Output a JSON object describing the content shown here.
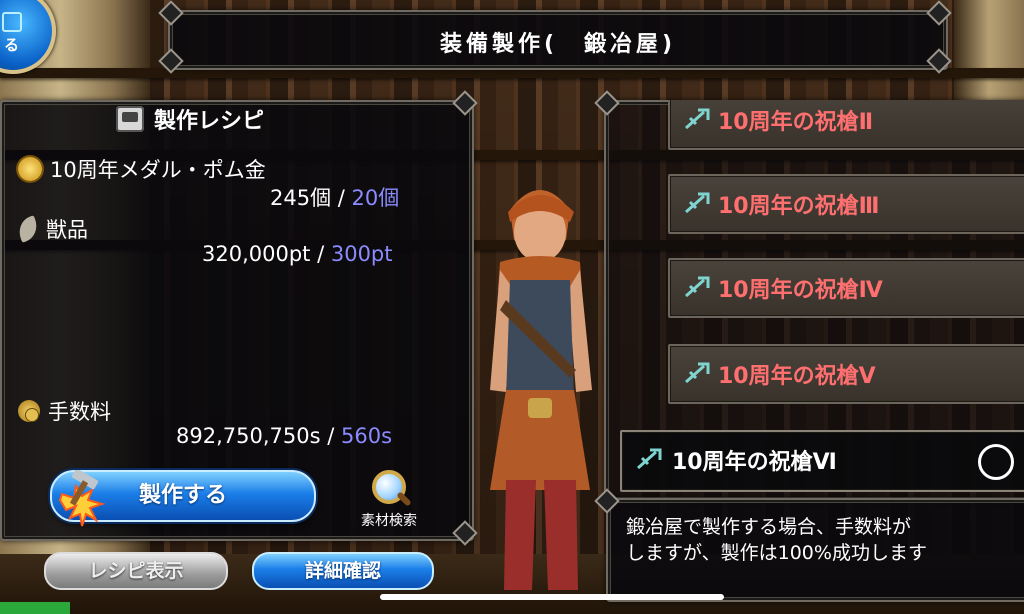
{
  "screen": {
    "title": "装備製作(　鍛冶屋)",
    "corner_button_label": "る"
  },
  "recipe": {
    "title": "製作レシピ",
    "materials": [
      {
        "name": "10周年メダル・ポム金",
        "owned": "245個",
        "sep": " / ",
        "required": "20個",
        "icon": "medal-icon"
      },
      {
        "name": "獣品",
        "owned": "320,000pt",
        "sep": " / ",
        "required": "300pt",
        "icon": "claw-icon"
      }
    ],
    "fee": {
      "name": "手数料",
      "owned": "892,750,750s",
      "sep": " / ",
      "required": "560s",
      "icon": "coin-icon"
    },
    "craft_button": "製作する",
    "search_label": "素材検索"
  },
  "bottom_buttons": {
    "recipe_view": "レシピ表示",
    "detail_confirm": "詳細確認"
  },
  "item_list": [
    {
      "label": "10周年の祝槍Ⅱ",
      "selected": false
    },
    {
      "label": "10周年の祝槍Ⅲ",
      "selected": false
    },
    {
      "label": "10周年の祝槍Ⅳ",
      "selected": false
    },
    {
      "label": "10周年の祝槍Ⅴ",
      "selected": false
    },
    {
      "label": "10周年の祝槍Ⅵ",
      "selected": true
    }
  ],
  "description": {
    "line1": "鍛冶屋で製作する場合、手数料が",
    "line2": "しますが、製作は100%成功します"
  },
  "colors": {
    "required_amount": "#8b8bff",
    "list_label": "#ff6f6f",
    "button_blue": "#1b7ee8"
  }
}
